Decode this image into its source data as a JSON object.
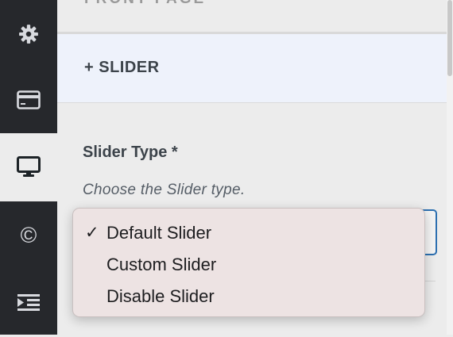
{
  "sidebar": {
    "items": [
      {
        "icon": "gear-icon"
      },
      {
        "icon": "card-icon"
      },
      {
        "icon": "desktop-icon",
        "active": true
      },
      {
        "icon": "copyright-icon",
        "glyph": "©"
      },
      {
        "icon": "indent-icon"
      }
    ]
  },
  "header": {
    "cut_title": "FRONT PAGE"
  },
  "section": {
    "title": "+ SLIDER"
  },
  "field": {
    "label": "Slider Type *",
    "description": "Choose the Slider type."
  },
  "dropdown": {
    "selected": "Default Slider",
    "options": [
      {
        "label": "Default Slider",
        "checked": true,
        "check_glyph": "✓"
      },
      {
        "label": "Custom Slider",
        "checked": false
      },
      {
        "label": "Disable Slider",
        "checked": false
      }
    ]
  }
}
